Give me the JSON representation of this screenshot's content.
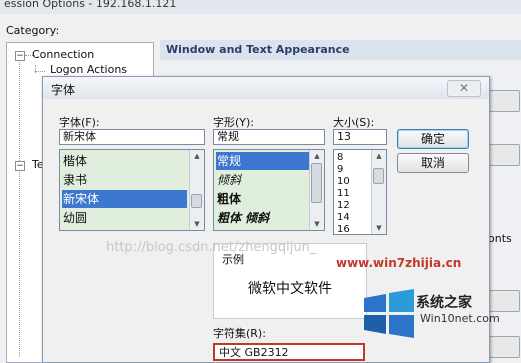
{
  "bg_window": {
    "title": "ession Options - 192.168.1.121",
    "category_label": "Category:",
    "tree": {
      "connection": "Connection",
      "logon_actions": "Logon Actions",
      "te": "Te"
    },
    "section_header": "Window and Text Appearance",
    "clip_onts": "onts"
  },
  "dialog": {
    "title": "字体",
    "close_icon": "✕",
    "font_label": "字体(F):",
    "font_value": "新宋体",
    "font_items": [
      "楷体",
      "隶书",
      "新宋体",
      "幼圆"
    ],
    "font_selected": 2,
    "style_label": "字形(Y):",
    "style_value": "常规",
    "style_items": [
      "常规",
      "倾斜",
      "粗体",
      "粗体 倾斜"
    ],
    "style_selected": 0,
    "size_label": "大小(S):",
    "size_value": "13",
    "size_items": [
      "8",
      "9",
      "10",
      "11",
      "12",
      "14",
      "16"
    ],
    "ok_button": "确定",
    "cancel_button": "取消",
    "sample_label": "示例",
    "sample_text": "微软中文软件",
    "charset_label": "字符集(R):",
    "charset_value": "中文 GB2312"
  },
  "watermark": "http://blog.csdn.net/zhengqijun_",
  "logo": {
    "win7": "www.win7zhijia.cn",
    "cn": "系统之家",
    "url": "Win10net.com"
  },
  "colors": {
    "selection": "#3d77d0",
    "list_bg": "#dfeedd",
    "header_text": "#2a3f66",
    "highlight_border": "#c0392b"
  }
}
